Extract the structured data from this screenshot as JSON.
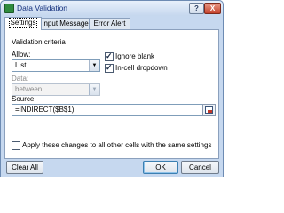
{
  "window": {
    "title": "Data Validation",
    "help_glyph": "?",
    "close_glyph": "X"
  },
  "tabs": [
    {
      "label": "Settings",
      "active": true
    },
    {
      "label": "Input Message",
      "active": false
    },
    {
      "label": "Error Alert",
      "active": false
    }
  ],
  "criteria": {
    "group_title": "Validation criteria",
    "allow_label": "Allow:",
    "allow_value": "List",
    "ignore_blank_label": "Ignore blank",
    "ignore_blank_checked": true,
    "in_cell_dropdown_label": "In-cell dropdown",
    "in_cell_dropdown_checked": true,
    "data_label": "Data:",
    "data_value": "between",
    "source_label": "Source:",
    "source_value": "=INDIRECT($B$1)"
  },
  "apply_all": {
    "label": "Apply these changes to all other cells with the same settings",
    "checked": false
  },
  "buttons": {
    "clear_all": "Clear All",
    "ok": "OK",
    "cancel": "Cancel"
  },
  "colors": {
    "title_text": "#15317e",
    "frame": "#c6d8ef",
    "close_button": "#c4412b"
  }
}
